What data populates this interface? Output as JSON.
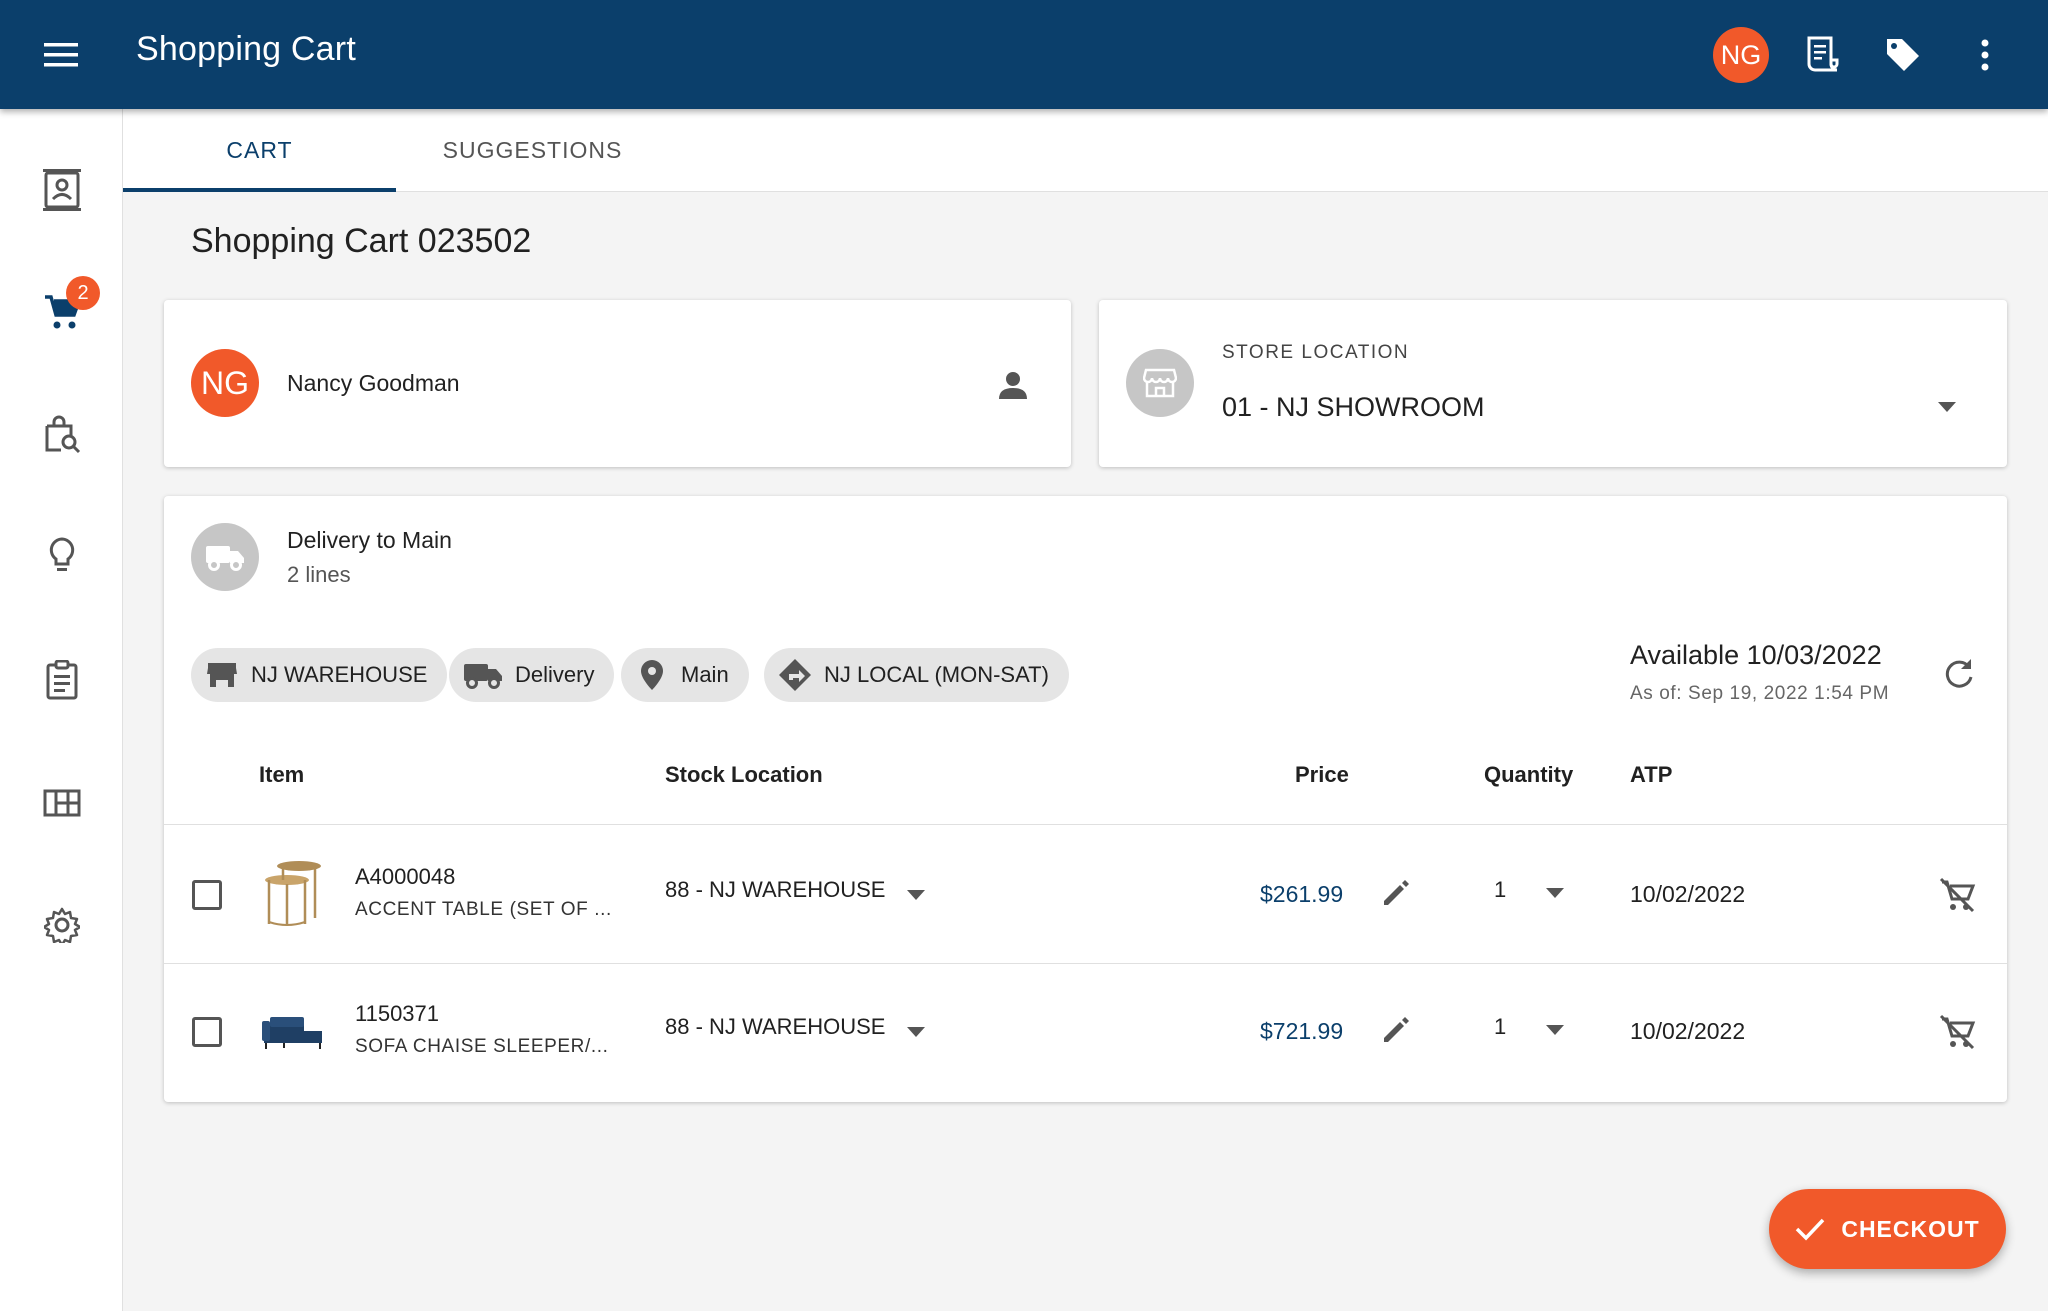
{
  "appbar": {
    "title": "Shopping Cart",
    "user_initials": "NG",
    "icons": [
      "menu-icon",
      "receipt-icon",
      "tag-icon",
      "more-vert-icon"
    ]
  },
  "rail": {
    "icons": [
      "contact-card-icon",
      "cart-icon",
      "product-search-icon",
      "lightbulb-icon",
      "clipboard-icon",
      "layout-grid-icon",
      "gear-icon"
    ],
    "cart_badge": "2"
  },
  "tabs": [
    {
      "label": "CART",
      "active": true
    },
    {
      "label": "SUGGESTIONS",
      "active": false
    }
  ],
  "page_title": "Shopping Cart 023502",
  "customer": {
    "initials": "NG",
    "name": "Nancy Goodman"
  },
  "store": {
    "label": "STORE LOCATION",
    "value": "01 - NJ SHOWROOM"
  },
  "delivery": {
    "title": "Delivery to Main",
    "lines": "2 lines",
    "chips": [
      "NJ WAREHOUSE",
      "Delivery",
      "Main",
      "NJ LOCAL (MON-SAT)"
    ],
    "available": "Available 10/03/2022",
    "as_of": "As of: Sep 19, 2022 1:54 PM"
  },
  "table": {
    "headers": {
      "item": "Item",
      "stock_location": "Stock Location",
      "price": "Price",
      "quantity": "Quantity",
      "atp": "ATP"
    },
    "rows": [
      {
        "sku": "A4000048",
        "description": "ACCENT TABLE (SET OF ...",
        "stock_location": "88 - NJ WAREHOUSE",
        "price": "$261.99",
        "quantity": "1",
        "atp": "10/02/2022"
      },
      {
        "sku": "1150371",
        "description": "SOFA CHAISE SLEEPER/...",
        "stock_location": "88 - NJ WAREHOUSE",
        "price": "$721.99",
        "quantity": "1",
        "atp": "10/02/2022"
      }
    ]
  },
  "checkout": {
    "label": "CHECKOUT"
  },
  "colors": {
    "primary": "#0b3f6b",
    "accent": "#f1592a",
    "background": "#f4f4f4"
  }
}
